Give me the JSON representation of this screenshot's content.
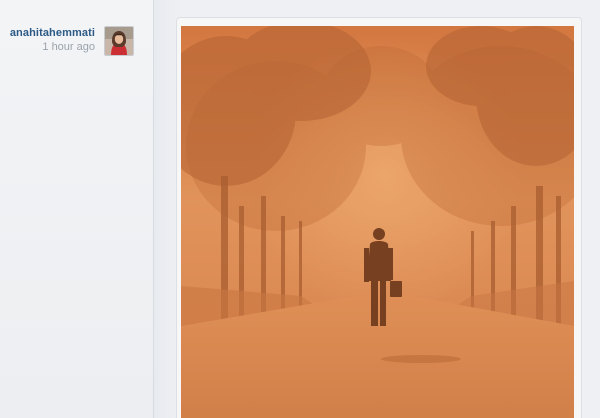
{
  "post": {
    "author": {
      "username": "anahitahemmati",
      "timestamp": "1 hour ago",
      "avatar": "user-avatar"
    },
    "photo": {
      "icon": "dust-storm-photo"
    }
  },
  "colors": {
    "username": "#2c5a86",
    "timestamp": "#9aa3ad",
    "rail_background": "#f0f2f4",
    "photo_tone": "#d67e45"
  }
}
